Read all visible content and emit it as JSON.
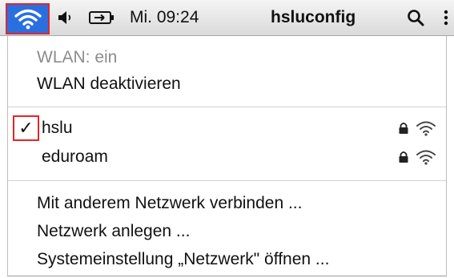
{
  "menubar": {
    "wifi_icon": "wifi-icon",
    "volume_icon": "speaker-icon",
    "battery_icon": "battery-icon",
    "clock": "Mi. 09:24",
    "user": "hsluconfig",
    "search_icon": "search-icon",
    "menu_icon": "list-icon",
    "highlight_color": "#2a6fe0",
    "annotation_color": "#e0262a"
  },
  "wifi_menu": {
    "status": "WLAN: ein",
    "toggle_label": "WLAN deaktivieren",
    "networks": [
      {
        "name": "hslu",
        "connected": true,
        "locked": true
      },
      {
        "name": "eduroam",
        "connected": false,
        "locked": true
      }
    ],
    "checkmark": "✓",
    "actions": [
      "Mit anderem Netzwerk verbinden ...",
      "Netzwerk anlegen ...",
      "Systemeinstellung „Netzwerk\" öffnen ..."
    ]
  }
}
